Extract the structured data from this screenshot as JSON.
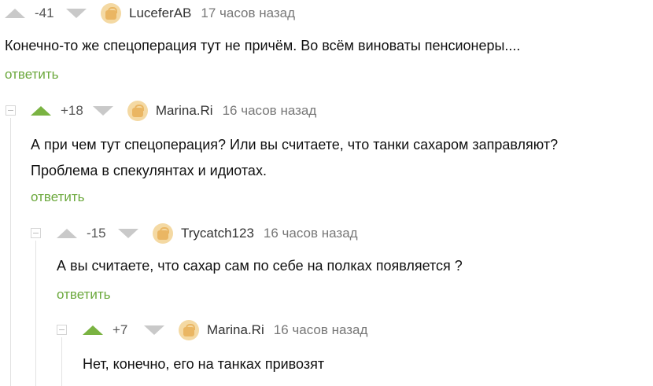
{
  "comments": [
    {
      "rating": "-41",
      "author": "LuceferAB",
      "time": "17 часов назад",
      "lines": [
        "Конечно-то же спецоперация тут не причём. Во всём виноваты пенсионеры...."
      ],
      "reply_label": "ответить",
      "upvoted": false
    },
    {
      "rating": "+18",
      "author": "Marina.Ri",
      "time": "16 часов назад",
      "lines": [
        "А при чем тут спецоперация? Или вы считаете, что танки сахаром заправляют?",
        "Проблема в спекулянтах и идиотах."
      ],
      "reply_label": "ответить",
      "upvoted": true
    },
    {
      "rating": "-15",
      "author": "Trycatch123",
      "time": "16 часов назад",
      "lines": [
        "А вы считаете, что сахар сам по себе на полках появляется ?"
      ],
      "reply_label": "ответить",
      "upvoted": false
    },
    {
      "rating": "+7",
      "author": "Marina.Ri",
      "time": "16 часов назад",
      "lines": [
        "Нет, конечно, его на танках привозят"
      ],
      "reply_label": "",
      "upvoted": true
    }
  ],
  "colors": {
    "upvote_active": "#7ab342",
    "reply_link": "#6ba83c",
    "arrow_inactive": "#c9c9c9"
  }
}
